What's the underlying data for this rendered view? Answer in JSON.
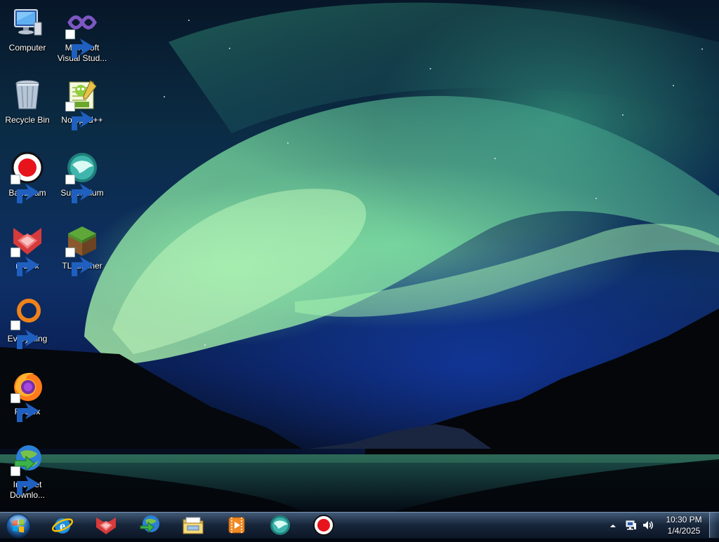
{
  "desktop": {
    "icons": [
      {
        "label": "Computer",
        "icon": "computer-icon",
        "shortcut": false
      },
      {
        "label": "Microsoft\nVisual Stud...",
        "icon": "visual-studio-icon",
        "shortcut": true
      },
      {
        "label": "Recycle Bin",
        "icon": "recycle-bin-icon",
        "shortcut": false
      },
      {
        "label": "Notepad++",
        "icon": "notepad-plus-plus-icon",
        "shortcut": true
      },
      {
        "label": "Bandicam",
        "icon": "bandicam-icon",
        "shortcut": true
      },
      {
        "label": "Supermium",
        "icon": "supermium-icon",
        "shortcut": true
      },
      {
        "label": "r3dfox",
        "icon": "r3dfox-icon",
        "shortcut": true
      },
      {
        "label": "TLauncher",
        "icon": "tlauncher-icon",
        "shortcut": true
      },
      {
        "label": "Everything",
        "icon": "everything-icon",
        "shortcut": true
      },
      {
        "label": "Firefox",
        "icon": "firefox-icon",
        "shortcut": true
      },
      {
        "label": "Internet\nDownlo...",
        "icon": "internet-download-manager-icon",
        "shortcut": true
      }
    ]
  },
  "taskbar": {
    "start_icon": "windows-start-orb-icon",
    "pinned": [
      {
        "name": "Internet Explorer",
        "icon": "internet-explorer-icon"
      },
      {
        "name": "r3dfox",
        "icon": "r3dfox-icon"
      },
      {
        "name": "Internet Download Manager",
        "icon": "internet-download-manager-icon"
      },
      {
        "name": "Windows Explorer",
        "icon": "folder-icon"
      },
      {
        "name": "Media Player",
        "icon": "media-player-icon"
      },
      {
        "name": "Supermium",
        "icon": "supermium-icon"
      },
      {
        "name": "Bandicam",
        "icon": "bandicam-icon"
      }
    ],
    "tray": {
      "icons": [
        "show-hidden-icons-arrow-icon",
        "network-icon",
        "volume-icon"
      ],
      "time": "10:30 PM",
      "date": "1/4/2025"
    }
  }
}
